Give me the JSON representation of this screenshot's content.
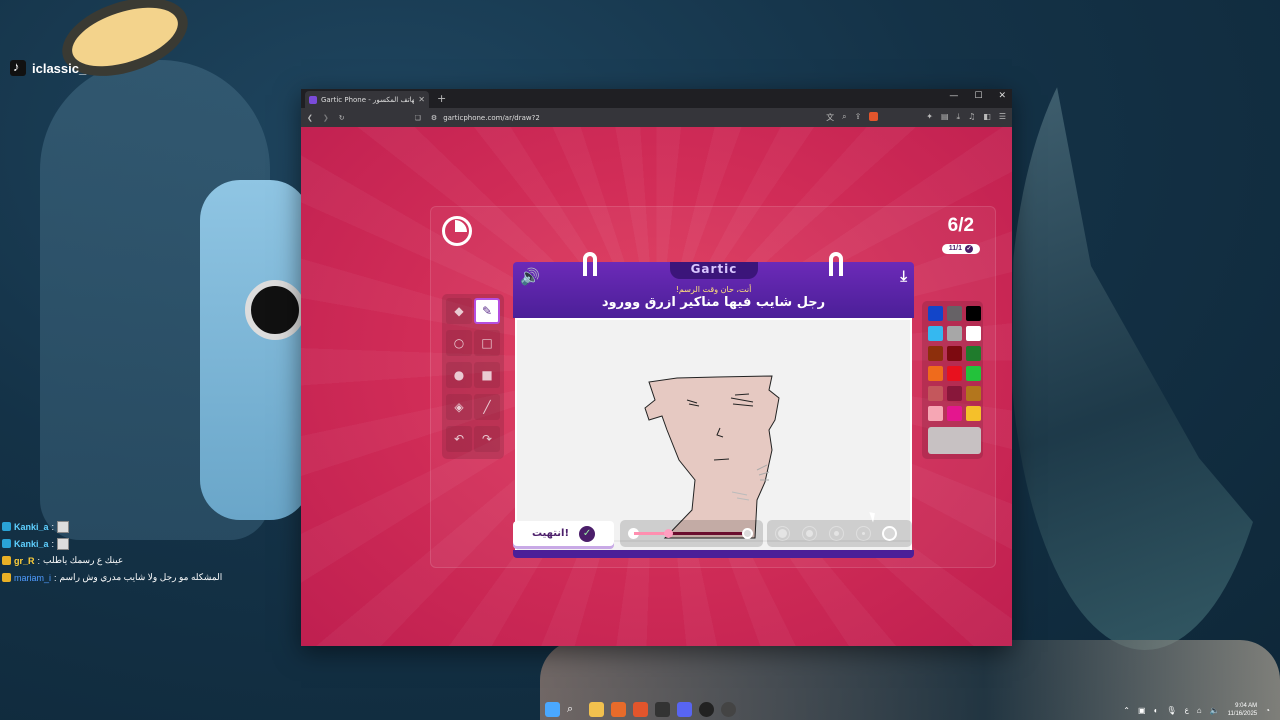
{
  "streamer": {
    "handle": "iclassic_"
  },
  "chat": [
    {
      "user": "Kanki_a",
      "message": "",
      "has_emote": true,
      "user_color": "gold"
    },
    {
      "user": "Kanki_a",
      "message": "",
      "has_emote": true,
      "user_color": "gold"
    },
    {
      "user": "gr_R",
      "message": "عينك ع رسمك ياطلب",
      "has_emote": false,
      "user_color": "gold"
    },
    {
      "user": "mariam_i",
      "message": "المشكله مو رجل ولا شايب مدري وش راسم",
      "has_emote": false,
      "user_color": "blue"
    }
  ],
  "browser": {
    "tab_title": "Gartic Phone - لعبة الهاتف المكسور",
    "new_tab_label": "+",
    "window_controls": [
      "—",
      "☐",
      "✕"
    ],
    "url": "garticphone.com/ar/draw?2"
  },
  "game": {
    "logo": "Gartic",
    "round": "6/2",
    "players_done": "11/1",
    "prompt_subtitle": "أنت، حان وقت الرسم!",
    "prompt": "رجل شايب فيها مناكير ازرق وورود",
    "done_button": "انتهيت!",
    "icons": {
      "timer": "timer-icon",
      "sound": "speaker-icon",
      "download": "download-icon"
    },
    "tools": [
      {
        "name": "eraser-tool",
        "glyph": "◆",
        "active": false
      },
      {
        "name": "pencil-tool",
        "glyph": "✎",
        "active": true
      },
      {
        "name": "ellipse-tool",
        "glyph": "○",
        "active": false
      },
      {
        "name": "rectangle-tool",
        "glyph": "□",
        "active": false
      },
      {
        "name": "filled-ellipse-tool",
        "glyph": "●",
        "active": false
      },
      {
        "name": "filled-rectangle-tool",
        "glyph": "■",
        "active": false
      },
      {
        "name": "fill-bucket-tool",
        "glyph": "◈",
        "active": false
      },
      {
        "name": "line-tool",
        "glyph": "╱",
        "active": false
      },
      {
        "name": "undo-tool",
        "glyph": "↶",
        "active": false
      },
      {
        "name": "redo-tool",
        "glyph": "↷",
        "active": false
      }
    ],
    "palette": [
      "#1245c9",
      "#666266",
      "#000000",
      "#35b8f0",
      "#a7a7a7",
      "#ffffff",
      "#8d2f0c",
      "#7d0a10",
      "#1f7b2c",
      "#ef6b1c",
      "#e8111e",
      "#23c23b",
      "#c4575c",
      "#88173a",
      "#b3761d",
      "#f6a6b4",
      "#e4168e",
      "#f5c02a"
    ],
    "current_color": "#c7c1c2",
    "opacity_value": 0.3,
    "brush_size_selected": 5
  },
  "taskbar": {
    "time": "9:04 AM",
    "date": "11/16/2025",
    "lang": "ع"
  }
}
